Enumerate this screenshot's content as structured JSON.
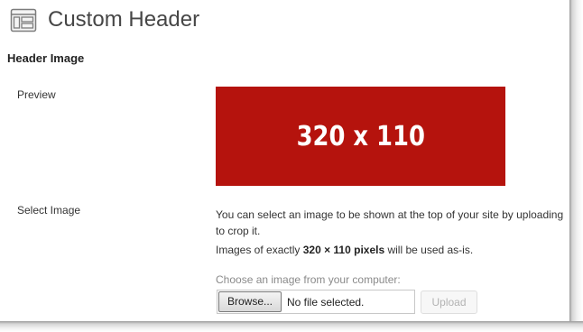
{
  "header": {
    "title": "Custom Header",
    "icon": "appearance-layout-icon"
  },
  "section": {
    "title": "Header Image"
  },
  "preview": {
    "label": "Preview",
    "image_text": "320 x 110",
    "image_color": "#b5130d"
  },
  "select_image": {
    "label": "Select Image",
    "description_line1": "You can select an image to be shown at the top of your site by uploading",
    "description_line2": "to crop it.",
    "size_prefix": "Images of exactly ",
    "size_value": "320 × 110 pixels",
    "size_suffix": " will be used as-is.",
    "choose_label": "Choose an image from your computer:",
    "browse_label": "Browse...",
    "file_status": "No file selected.",
    "upload_label": "Upload"
  }
}
